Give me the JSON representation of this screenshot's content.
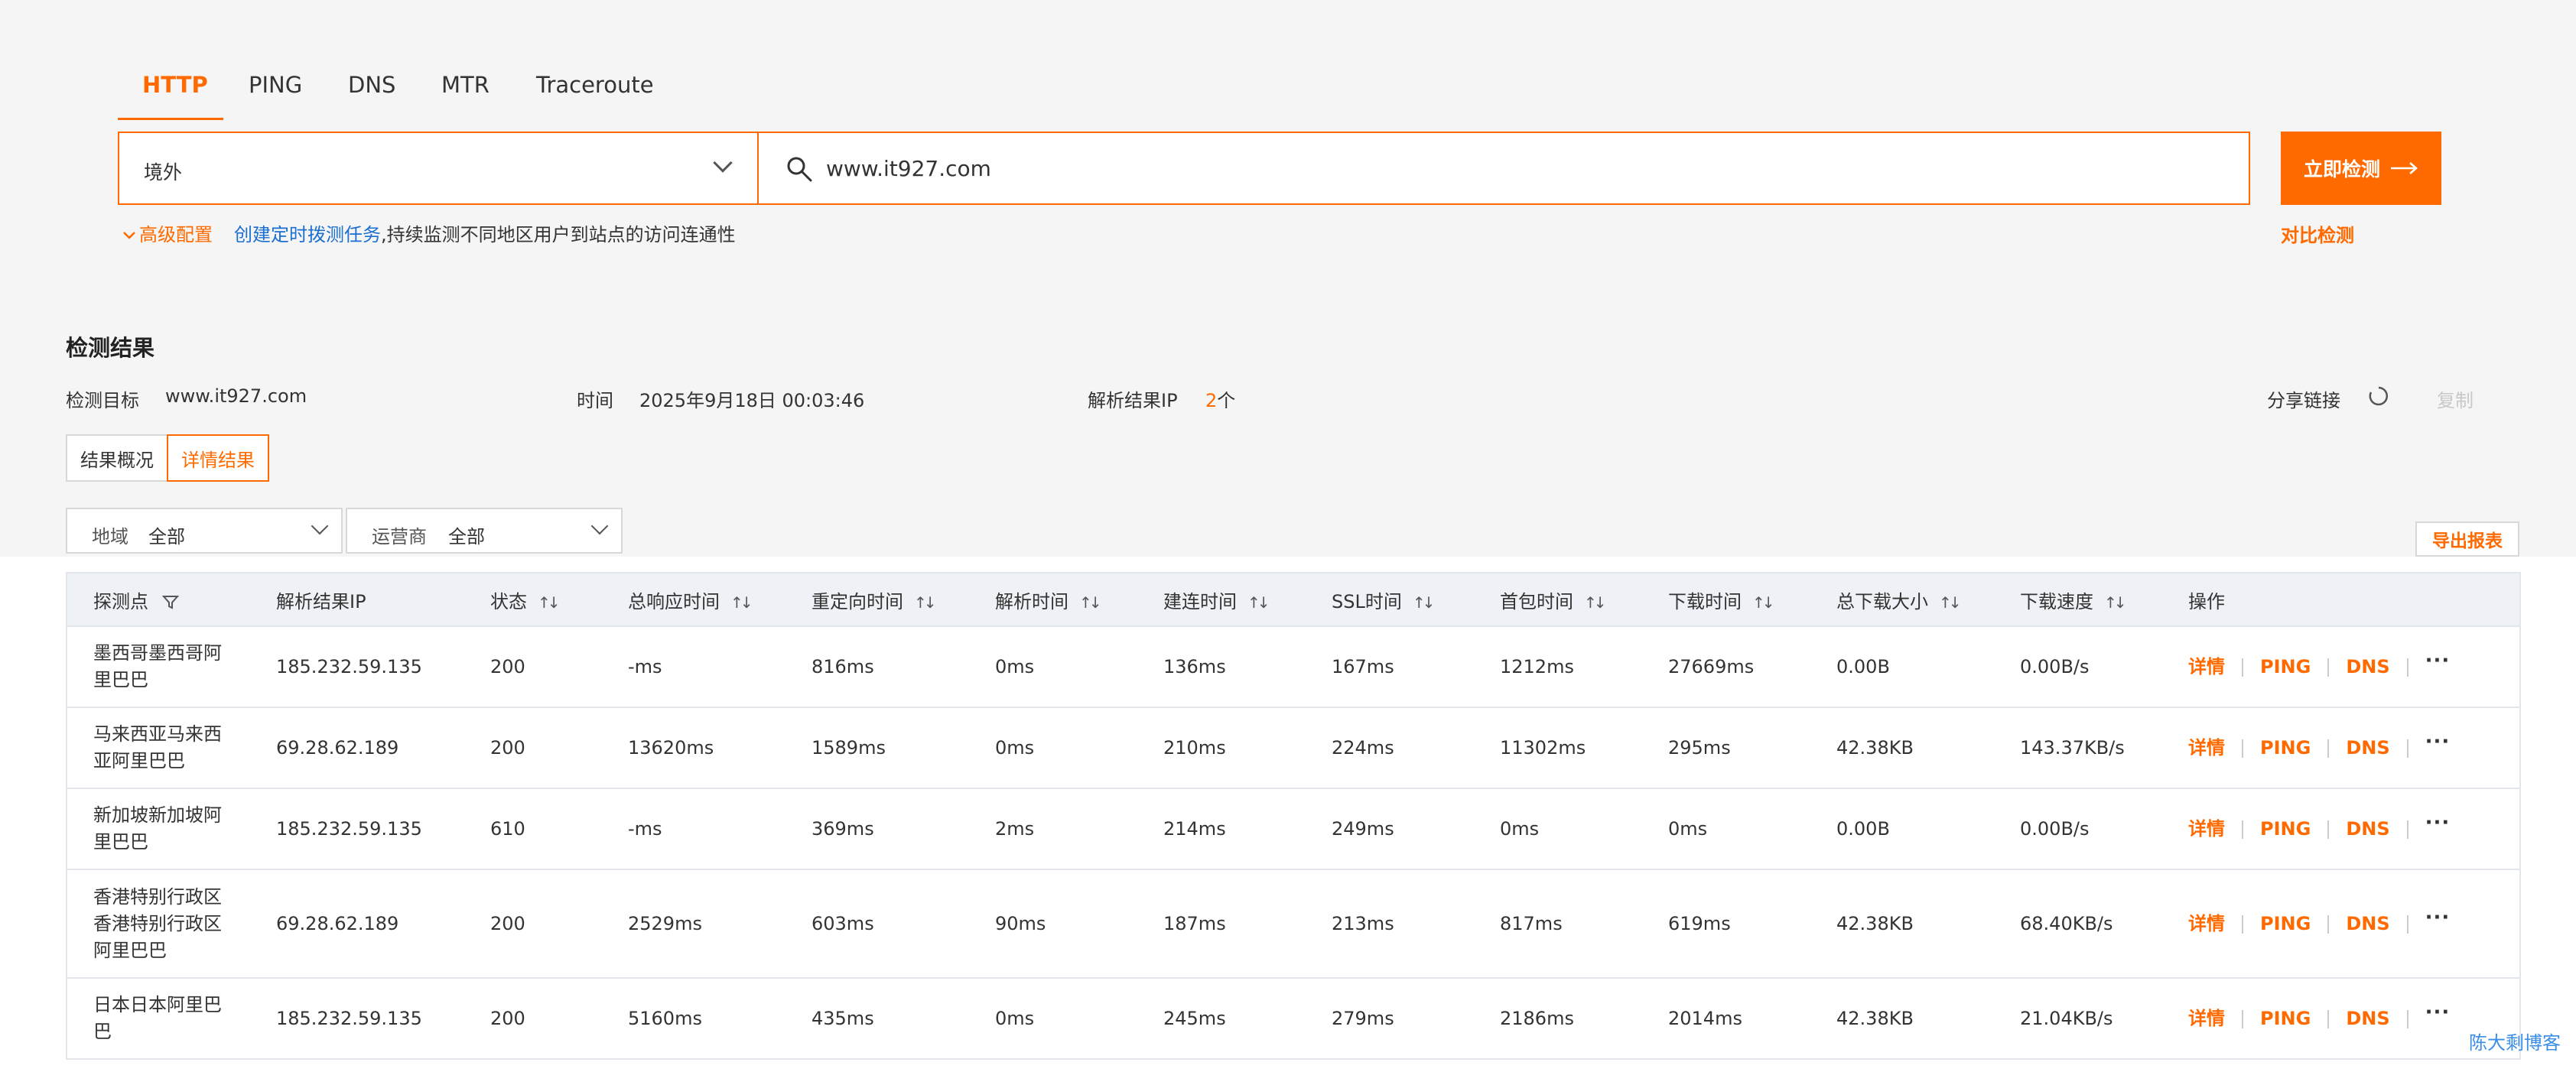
{
  "tabs": [
    "HTTP",
    "PING",
    "DNS",
    "MTR",
    "Traceroute"
  ],
  "region_select": {
    "value": "境外"
  },
  "search": {
    "value": "www.it927.com"
  },
  "go_button": "立即检测",
  "advanced": "高级配置",
  "create_task_link": "创建定时拨测任务",
  "create_task_desc": ",持续监测不同地区用户到站点的访问连通性",
  "compare": "对比检测",
  "result": {
    "title": "检测结果",
    "target_label": "检测目标",
    "target": "www.it927.com",
    "time_label": "时间",
    "time": "2025年9月18日 00:03:46",
    "ip_label": "解析结果IP",
    "ip_count": "2",
    "ip_unit": "个",
    "share": "分享链接",
    "copy": "复制"
  },
  "view_buttons": [
    "结果概况",
    "详情结果"
  ],
  "filters": {
    "region_label": "地域",
    "region_value": "全部",
    "isp_label": "运营商",
    "isp_value": "全部"
  },
  "export": "导出报表",
  "columns": [
    "探测点",
    "解析结果IP",
    "状态",
    "总响应时间",
    "重定向时间",
    "解析时间",
    "建连时间",
    "SSL时间",
    "首包时间",
    "下载时间",
    "总下载大小",
    "下载速度",
    "操作"
  ],
  "ops": [
    "详情",
    "PING",
    "DNS"
  ],
  "rows": [
    {
      "point": "墨西哥墨西哥阿里巴巴",
      "ip": "185.232.59.135",
      "status": "200",
      "total": "-ms",
      "redirect": "816ms",
      "dns": "0ms",
      "connect": "136ms",
      "ssl": "167ms",
      "first": "1212ms",
      "download": "27669ms",
      "size": "0.00B",
      "speed": "0.00B/s"
    },
    {
      "point": "马来西亚马来西亚阿里巴巴",
      "ip": "69.28.62.189",
      "status": "200",
      "total": "13620ms",
      "redirect": "1589ms",
      "dns": "0ms",
      "connect": "210ms",
      "ssl": "224ms",
      "first": "11302ms",
      "download": "295ms",
      "size": "42.38KB",
      "speed": "143.37KB/s"
    },
    {
      "point": "新加坡新加坡阿里巴巴",
      "ip": "185.232.59.135",
      "status": "610",
      "total": "-ms",
      "redirect": "369ms",
      "dns": "2ms",
      "connect": "214ms",
      "ssl": "249ms",
      "first": "0ms",
      "download": "0ms",
      "size": "0.00B",
      "speed": "0.00B/s"
    },
    {
      "point": "香港特别行政区香港特别行政区阿里巴巴",
      "ip": "69.28.62.189",
      "status": "200",
      "total": "2529ms",
      "redirect": "603ms",
      "dns": "90ms",
      "connect": "187ms",
      "ssl": "213ms",
      "first": "817ms",
      "download": "619ms",
      "size": "42.38KB",
      "speed": "68.40KB/s"
    },
    {
      "point": "日本日本阿里巴巴",
      "ip": "185.232.59.135",
      "status": "200",
      "total": "5160ms",
      "redirect": "435ms",
      "dns": "0ms",
      "connect": "245ms",
      "ssl": "279ms",
      "first": "2186ms",
      "download": "2014ms",
      "size": "42.38KB",
      "speed": "21.04KB/s"
    }
  ],
  "watermark": "陈大剩博客"
}
